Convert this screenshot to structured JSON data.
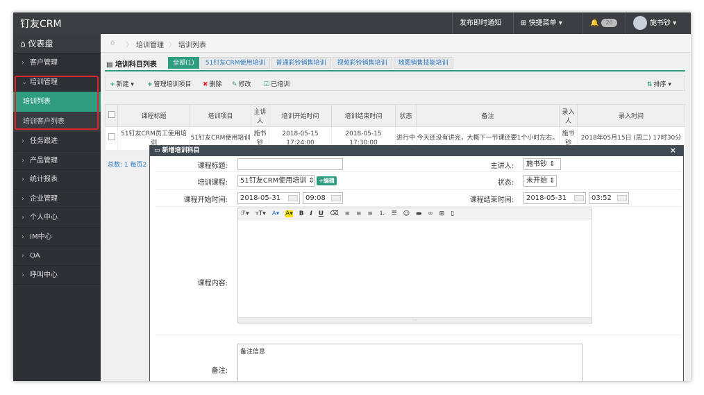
{
  "app": {
    "brand": "钉友CRM"
  },
  "topbar": {
    "notice": "发布即时通知",
    "quick_menu": "快捷菜单",
    "badge": "26",
    "user": "施书钞"
  },
  "sidebar": {
    "dashboard": "仪表盘",
    "items": [
      {
        "label": "客户管理"
      },
      {
        "label": "培训管理"
      },
      {
        "label": "任务跟进"
      },
      {
        "label": "产品管理"
      },
      {
        "label": "统计报表"
      },
      {
        "label": "企业管理"
      },
      {
        "label": "个人中心"
      },
      {
        "label": "IM中心"
      },
      {
        "label": "OA"
      },
      {
        "label": "呼叫中心"
      }
    ],
    "sub_items": [
      {
        "label": "培训列表"
      },
      {
        "label": "培训客户列表"
      }
    ]
  },
  "breadcrumb": {
    "level1": "培训管理",
    "level2": "培训列表"
  },
  "page": {
    "title": "培训科目列表"
  },
  "tabs": [
    {
      "label": "全部(1)"
    },
    {
      "label": "51钉友CRM使用培训"
    },
    {
      "label": "普通彩铃销售培训"
    },
    {
      "label": "视频彩铃销售培训"
    },
    {
      "label": "地图销售技能培训"
    }
  ],
  "toolbar": {
    "new": "新建",
    "manage": "管理培训项目",
    "delete": "删除",
    "edit": "修改",
    "trained": "已培训",
    "sort": "排序"
  },
  "table": {
    "headers": [
      "课程标题",
      "培训项目",
      "主讲人",
      "培训开始时间",
      "培训结束时间",
      "状态",
      "备注",
      "录入人",
      "录入时间"
    ],
    "rows": [
      {
        "title": "51钉友CRM员工使用培训",
        "project": "51钉友CRM使用培训",
        "speaker": "施书钞",
        "start": "2018-05-15 17:24:00",
        "end": "2018-05-15 17:30:00",
        "status": "进行中",
        "remark": "今天还没有讲完，大概下一节课还要1个小时左右。",
        "creator": "施书钞",
        "created": "2018年05月15日 (周二) 17时30分"
      }
    ],
    "total": "总数: 1 每页2"
  },
  "modal": {
    "title": "新增培训科目",
    "close": "×",
    "labels": {
      "course_title": "课程标题:",
      "speaker": "主讲人:",
      "course": "培训课程:",
      "status": "状态:",
      "start": "课程开始时间:",
      "end": "课程结束时间:",
      "content": "课程内容:",
      "remark": "备注:"
    },
    "values": {
      "course_title": "",
      "speaker": "施书钞",
      "course": "51钉友CRM使用培训",
      "status": "未开始",
      "start_date": "2018-05-31",
      "start_time": "09:08",
      "end_date": "2018-05-31",
      "end_time": "03:52",
      "remark_placeholder": "备注信息"
    },
    "edit_btn": "+编辑"
  }
}
